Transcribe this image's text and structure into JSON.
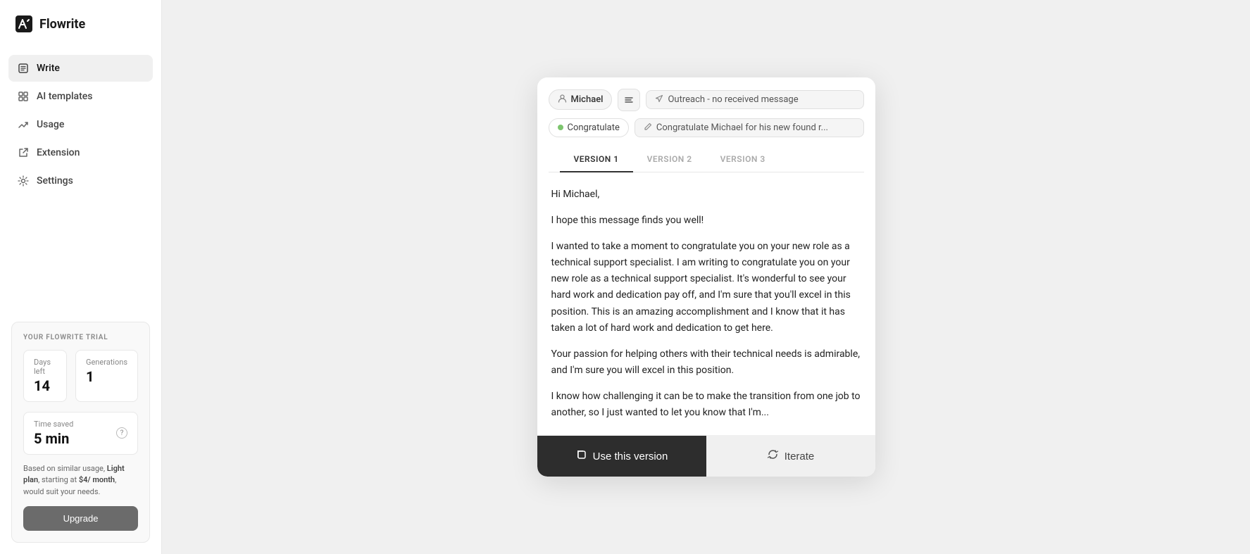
{
  "app": {
    "logo_text": "Flowrite",
    "logo_icon": "✍"
  },
  "sidebar": {
    "nav_items": [
      {
        "id": "write",
        "label": "Write",
        "icon": "edit",
        "active": true
      },
      {
        "id": "ai-templates",
        "label": "AI templates",
        "icon": "grid"
      },
      {
        "id": "usage",
        "label": "Usage",
        "icon": "trending-up"
      },
      {
        "id": "extension",
        "label": "Extension",
        "icon": "external-link"
      },
      {
        "id": "settings",
        "label": "Settings",
        "icon": "settings"
      }
    ],
    "trial": {
      "title": "Your Flowrite Trial",
      "days_left_label": "Days left",
      "days_left_value": "14",
      "generations_label": "Generations",
      "generations_value": "1",
      "time_saved_label": "Time saved",
      "time_saved_value": "5 min",
      "description": "Based on similar usage, ",
      "plan_name": "Light plan",
      "plan_suffix": ", starting at ",
      "price": "$4/ month",
      "price_suffix": ", would suit your needs.",
      "upgrade_label": "Upgrade"
    }
  },
  "modal": {
    "person_name": "Michael",
    "outreach_label": "Outreach - no received message",
    "congratulate_label": "Congratulate",
    "prompt_label": "Congratulate Michael for his new found r...",
    "tabs": [
      {
        "id": "v1",
        "label": "VERSION 1",
        "active": true
      },
      {
        "id": "v2",
        "label": "VERSION 2",
        "active": false
      },
      {
        "id": "v3",
        "label": "VERSION 3",
        "active": false
      }
    ],
    "email": {
      "greeting": "Hi Michael,",
      "p1": "I hope this message finds you well!",
      "p2": "I wanted to take a moment to congratulate you on your new role as a technical support specialist. I am writing to congratulate you on your new role as a technical support specialist. It's wonderful to see your hard work and dedication pay off, and I'm sure that you'll excel in this position. This is an amazing accomplishment and I know that it has taken a lot of hard work and dedication to get here.",
      "p3": "Your passion for helping others with their technical needs is admirable, and I'm sure you will excel in this position.",
      "p4": "I know how challenging it can be to make the transition from one job to another, so I just wanted to let you know that I'm..."
    },
    "use_version_label": "Use this version",
    "iterate_label": "Iterate"
  }
}
